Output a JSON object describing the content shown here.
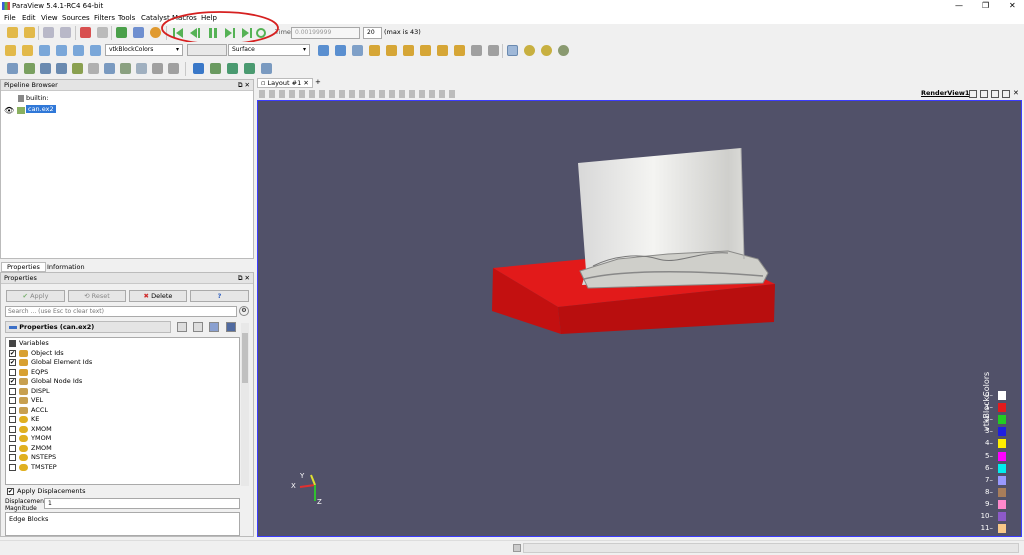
{
  "window": {
    "title": "ParaView 5.4.1-RC4 64-bit",
    "min": "—",
    "max": "❐",
    "close": "✕"
  },
  "menu": [
    "File",
    "Edit",
    "View",
    "Sources",
    "Filters",
    "Tools",
    "Catalyst",
    "Macros",
    "Help"
  ],
  "time": {
    "label": "Time:",
    "value": "0.00199999",
    "step": "20",
    "max_note": "(max is 43)"
  },
  "toolbar2": {
    "color_by": "vtkBlockColors",
    "repr_blank": "",
    "representation": "Surface"
  },
  "pipeline": {
    "title": "Pipeline Browser",
    "root": "builtin:",
    "item": "can.ex2"
  },
  "tabs": {
    "properties": "Properties",
    "information": "Information"
  },
  "properties": {
    "title": "Properties",
    "apply": "Apply",
    "reset": "Reset",
    "delete": "Delete",
    "help": "?",
    "search_placeholder": "Search ... (use Esc to clear text)",
    "section": "Properties (can.ex2)",
    "variables_header": "Variables",
    "vars": [
      {
        "name": "Object Ids",
        "checked": true
      },
      {
        "name": "Global Element Ids",
        "checked": true
      },
      {
        "name": "EQPS",
        "checked": false
      },
      {
        "name": "Global Node Ids",
        "checked": true
      },
      {
        "name": "DISPL",
        "checked": false
      },
      {
        "name": "VEL",
        "checked": false
      },
      {
        "name": "ACCL",
        "checked": false
      },
      {
        "name": "KE",
        "checked": false
      },
      {
        "name": "XMOM",
        "checked": false
      },
      {
        "name": "YMOM",
        "checked": false
      },
      {
        "name": "ZMOM",
        "checked": false
      },
      {
        "name": "NSTEPS",
        "checked": false
      },
      {
        "name": "TMSTEP",
        "checked": false
      }
    ],
    "apply_disp": "Apply Displacements",
    "disp_mag_label": "Displacement Magnitude",
    "disp_mag_value": "1",
    "edge_blocks": "Edge Blocks"
  },
  "layout": {
    "tab": "Layout #1",
    "close": "✕",
    "add": "+",
    "render_view": "RenderView1"
  },
  "legend": {
    "title": "vtkBlockColors",
    "labels": [
      "0",
      "1",
      "2",
      "3",
      "4",
      "5",
      "6",
      "7",
      "8",
      "9",
      "10",
      "11"
    ],
    "colors": [
      "#ffffff",
      "#e41a1c",
      "#22cc22",
      "#1f1fe0",
      "#ffee00",
      "#ff00ff",
      "#00eeee",
      "#9999ff",
      "#a87d5a",
      "#ff88cc",
      "#8d5ac8",
      "#f8c888"
    ]
  },
  "axes": {
    "x": "X",
    "y": "Y",
    "z": "Z"
  }
}
